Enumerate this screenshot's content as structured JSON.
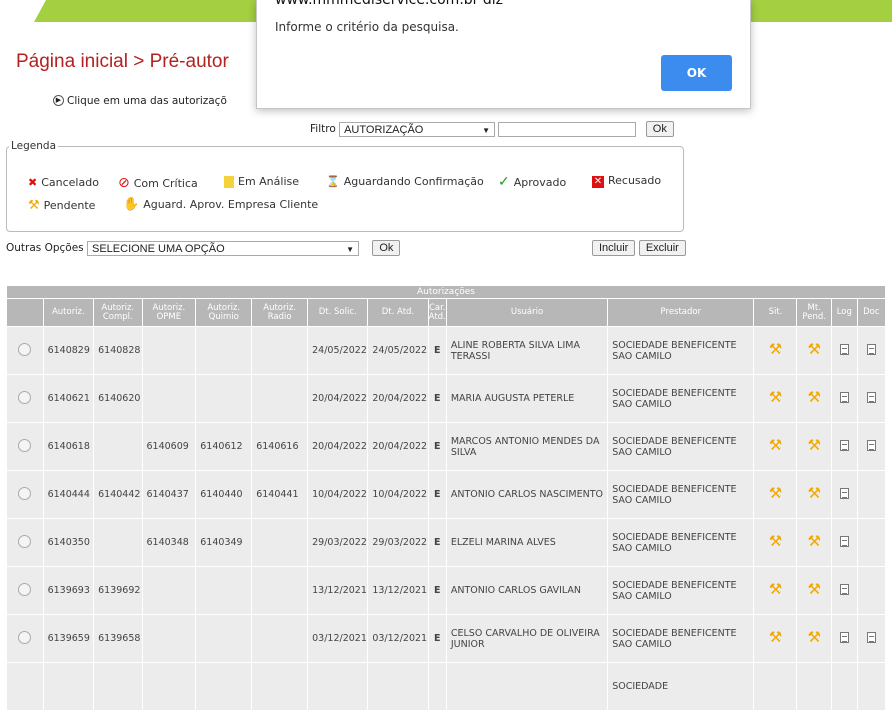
{
  "header": {
    "title": "Página inicial > Pré-autor"
  },
  "hint": {
    "text": "Clique em uma das autorizaçõ"
  },
  "filter": {
    "label": "Filtro",
    "select_value": "AUTORIZAÇÃO",
    "input_value": "",
    "ok_label": "Ok"
  },
  "legend": {
    "title": "Legenda",
    "items": [
      "Cancelado",
      "Com Crítica",
      "Em Análise",
      "Aguardando Confirmação",
      "Aprovado",
      "Recusado",
      "Pendente",
      "Aguard. Aprov. Empresa Cliente"
    ]
  },
  "options": {
    "label": "Outras Opções",
    "select_value": "SELECIONE UMA OPÇÃO",
    "ok_label": "Ok",
    "incluir_label": "Incluir",
    "excluir_label": "Excluir"
  },
  "table": {
    "caption": "Autorizações",
    "headers": [
      "Autoriz.",
      "Autoriz. Compl.",
      "Autoriz. OPME",
      "Autoriz. Quimio",
      "Autoriz. Radio",
      "Dt. Solic.",
      "Dt. Atd.",
      "Car. Atd.",
      "Usuário",
      "Prestador",
      "Sit.",
      "Mt. Pend.",
      "Log",
      "Doc"
    ],
    "rows": [
      {
        "autoriz": "6140829",
        "compl": "6140828",
        "opme": "",
        "quimio": "",
        "radio": "",
        "dt_solic": "24/05/2022",
        "dt_atd": "24/05/2022",
        "car": "E",
        "usuario": "ALINE ROBERTA SILVA LIMA TERASSI",
        "prestador": "SOCIEDADE BENEFICENTE SAO CAMILO",
        "mt": true,
        "doc": true
      },
      {
        "autoriz": "6140621",
        "compl": "6140620",
        "opme": "",
        "quimio": "",
        "radio": "",
        "dt_solic": "20/04/2022",
        "dt_atd": "20/04/2022",
        "car": "E",
        "usuario": "MARIA AUGUSTA PETERLE",
        "prestador": "SOCIEDADE BENEFICENTE SAO CAMILO",
        "mt": true,
        "doc": true
      },
      {
        "autoriz": "6140618",
        "compl": "",
        "opme": "6140609",
        "quimio": "6140612",
        "radio": "6140616",
        "dt_solic": "20/04/2022",
        "dt_atd": "20/04/2022",
        "car": "E",
        "usuario": "MARCOS ANTONIO MENDES DA SILVA",
        "prestador": "SOCIEDADE BENEFICENTE SAO CAMILO",
        "mt": true,
        "doc": true
      },
      {
        "autoriz": "6140444",
        "compl": "6140442",
        "opme": "6140437",
        "quimio": "6140440",
        "radio": "6140441",
        "dt_solic": "10/04/2022",
        "dt_atd": "10/04/2022",
        "car": "E",
        "usuario": "ANTONIO CARLOS NASCIMENTO",
        "prestador": "SOCIEDADE BENEFICENTE SAO CAMILO",
        "mt": true,
        "doc": false
      },
      {
        "autoriz": "6140350",
        "compl": "",
        "opme": "6140348",
        "quimio": "6140349",
        "radio": "",
        "dt_solic": "29/03/2022",
        "dt_atd": "29/03/2022",
        "car": "E",
        "usuario": "ELZELI MARINA ALVES",
        "prestador": "SOCIEDADE BENEFICENTE SAO CAMILO",
        "mt": true,
        "doc": false
      },
      {
        "autoriz": "6139693",
        "compl": "6139692",
        "opme": "",
        "quimio": "",
        "radio": "",
        "dt_solic": "13/12/2021",
        "dt_atd": "13/12/2021",
        "car": "E",
        "usuario": "ANTONIO CARLOS GAVILAN",
        "prestador": "SOCIEDADE BENEFICENTE SAO CAMILO",
        "mt": true,
        "doc": false
      },
      {
        "autoriz": "6139659",
        "compl": "6139658",
        "opme": "",
        "quimio": "",
        "radio": "",
        "dt_solic": "03/12/2021",
        "dt_atd": "03/12/2021",
        "car": "E",
        "usuario": "CELSO CARVALHO DE OLIVEIRA JUNIOR",
        "prestador": "SOCIEDADE BENEFICENTE SAO CAMILO",
        "mt": true,
        "doc": true
      },
      {
        "autoriz": "",
        "compl": "",
        "opme": "",
        "quimio": "",
        "radio": "",
        "dt_solic": "",
        "dt_atd": "",
        "car": "",
        "usuario": "",
        "prestador": "SOCIEDADE",
        "mt": false,
        "doc": false
      }
    ]
  },
  "dialog": {
    "origin": "www.mmmediservice.com.br diz",
    "message": "Informe o critério da pesquisa.",
    "ok_label": "OK"
  },
  "colors": {
    "brand_green": "#a3cf41",
    "title_red": "#b22222",
    "ok_blue": "#3c8cf0",
    "pendente_yellow": "#f0a800"
  },
  "icons": [
    "info-bullet-icon",
    "x-icon",
    "no-entry-icon",
    "notepad-icon",
    "hourglass-icon",
    "check-icon",
    "x-box-icon",
    "wrench-icon",
    "hand-icon",
    "log-document-icon",
    "doc-document-icon"
  ]
}
